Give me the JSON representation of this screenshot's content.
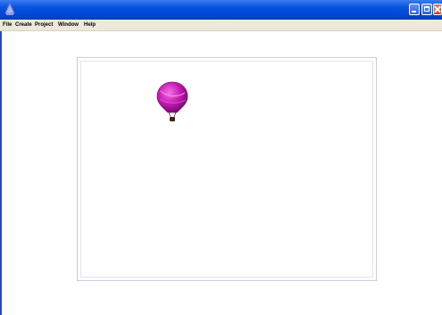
{
  "window": {
    "title": "",
    "controls": {
      "minimize": "minimize-icon",
      "maximize": "maximize-icon",
      "close": "close-icon"
    },
    "colors": {
      "titlebar": "#0a55e0",
      "menubar": "#ece9d8",
      "close": "#c9411e"
    }
  },
  "menu": {
    "items": [
      {
        "label": "File"
      },
      {
        "label": "Create"
      },
      {
        "label": "Project"
      },
      {
        "label": "Window"
      },
      {
        "label": "Help"
      }
    ]
  },
  "canvas": {
    "sprites": [
      {
        "name": "hot-air-balloon",
        "icon": "balloon-icon",
        "color": "#c81ab4"
      }
    ]
  }
}
